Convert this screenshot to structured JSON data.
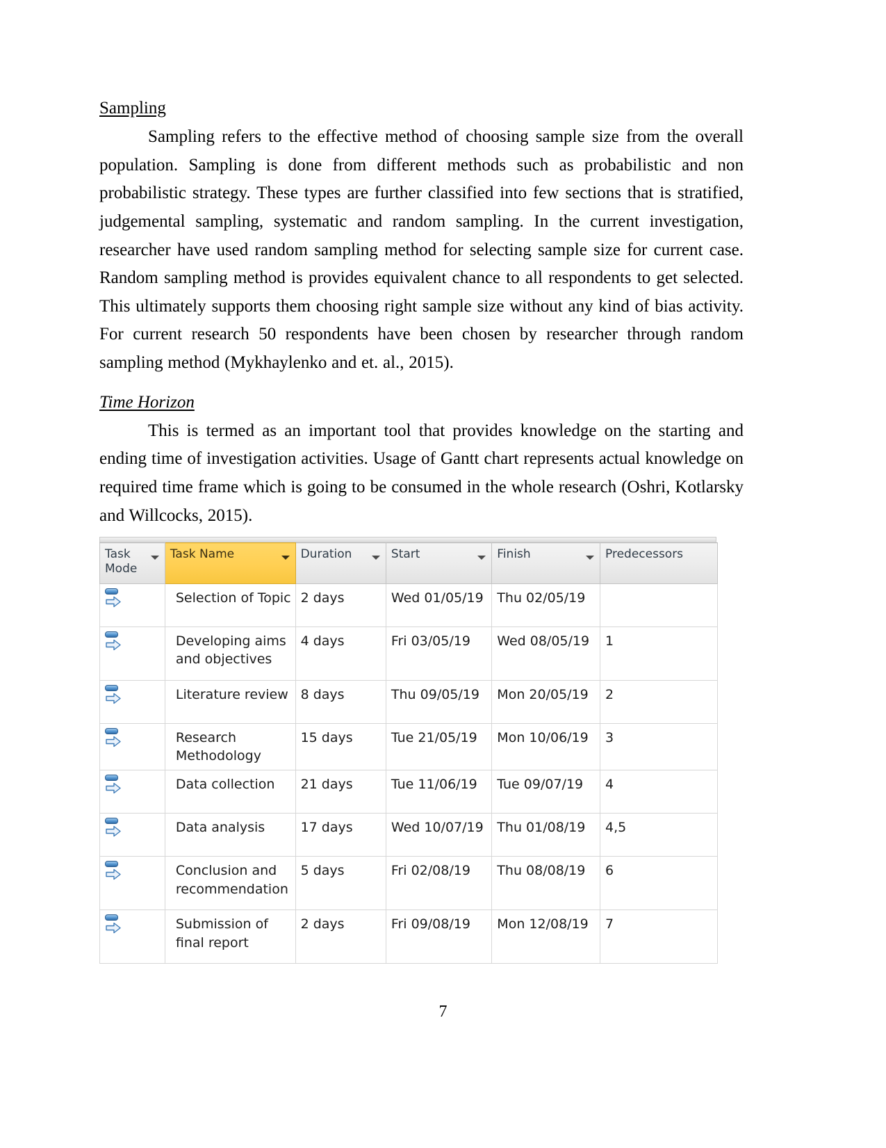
{
  "document": {
    "sections": [
      {
        "heading": "Sampling",
        "heading_style": "underline",
        "paragraph": "Sampling refers to the effective method of choosing sample size from the overall population. Sampling is done from different methods such as probabilistic and non probabilistic strategy. These types are further classified into few sections that is stratified, judgemental sampling, systematic and random sampling.   In the current investigation, researcher have used random sampling method for selecting sample size for current case. Random sampling method is provides equivalent chance to all respondents to get selected. This ultimately supports them choosing right sample size without any kind of bias activity. For current research 50 respondents have been chosen by researcher through random sampling method (Mykhaylenko and et. al., 2015)."
      },
      {
        "heading": "Time Horizon",
        "heading_style": "italic-underline",
        "paragraph": "This is termed as an important tool that provides knowledge on the starting and ending time of investigation activities. Usage of Gantt chart represents actual knowledge on required time frame which is going to be consumed in the whole research (Oshri, Kotlarsky and Willcocks, 2015)."
      }
    ],
    "page_number": "7"
  },
  "gantt_table": {
    "accent_header_color": "#ffcf52",
    "headers": [
      {
        "label": "Task Mode",
        "key": "mode",
        "has_filter": true,
        "highlighted": false
      },
      {
        "label": "Task Name",
        "key": "name",
        "has_filter": true,
        "highlighted": true
      },
      {
        "label": "Duration",
        "key": "duration",
        "has_filter": true,
        "highlighted": false
      },
      {
        "label": "Start",
        "key": "start",
        "has_filter": true,
        "highlighted": false
      },
      {
        "label": "Finish",
        "key": "finish",
        "has_filter": true,
        "highlighted": false
      },
      {
        "label": "Predecessors",
        "key": "predecessors",
        "has_filter": false,
        "highlighted": false
      }
    ],
    "rows": [
      {
        "mode_icon": "auto-schedule-icon",
        "name": "Selection of Topic",
        "duration": "2 days",
        "start": "Wed 01/05/19",
        "finish": "Thu 02/05/19",
        "predecessors": ""
      },
      {
        "mode_icon": "auto-schedule-icon",
        "name": "Developing aims and objectives",
        "duration": "4 days",
        "start": "Fri 03/05/19",
        "finish": "Wed 08/05/19",
        "predecessors": "1"
      },
      {
        "mode_icon": "auto-schedule-icon",
        "name": "Literature review",
        "duration": "8 days",
        "start": "Thu 09/05/19",
        "finish": "Mon 20/05/19",
        "predecessors": "2"
      },
      {
        "mode_icon": "auto-schedule-icon",
        "name": "Research Methodology",
        "duration": "15 days",
        "start": "Tue 21/05/19",
        "finish": "Mon 10/06/19",
        "predecessors": "3"
      },
      {
        "mode_icon": "auto-schedule-icon",
        "name": "Data collection",
        "duration": "21 days",
        "start": "Tue 11/06/19",
        "finish": "Tue 09/07/19",
        "predecessors": "4"
      },
      {
        "mode_icon": "auto-schedule-icon",
        "name": "Data analysis",
        "duration": "17 days",
        "start": "Wed 10/07/19",
        "finish": "Thu 01/08/19",
        "predecessors": "4,5"
      },
      {
        "mode_icon": "auto-schedule-icon",
        "name": "Conclusion and recommendation",
        "duration": "5 days",
        "start": "Fri 02/08/19",
        "finish": "Thu 08/08/19",
        "predecessors": "6"
      },
      {
        "mode_icon": "auto-schedule-icon",
        "name": "Submission of final report",
        "duration": "2 days",
        "start": "Fri 09/08/19",
        "finish": "Mon 12/08/19",
        "predecessors": "7"
      }
    ]
  }
}
